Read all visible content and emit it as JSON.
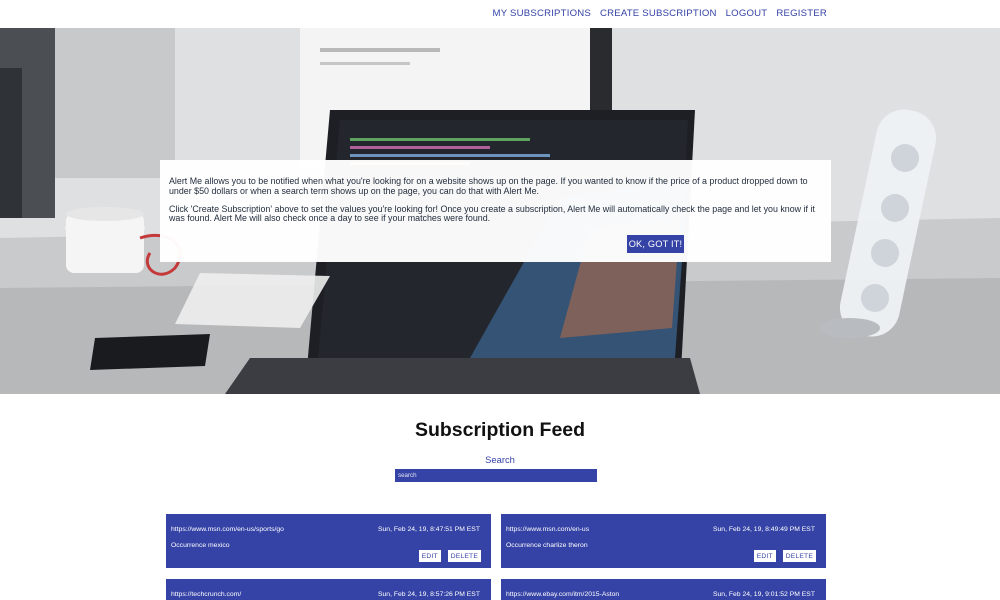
{
  "nav": {
    "my_subscriptions": "MY SUBSCRIPTIONS",
    "create_subscription": "CREATE SUBSCRIPTION",
    "logout": "LOGOUT",
    "register": "REGISTER"
  },
  "intro": {
    "paragraph1": "Alert Me allows you to be notified when what you're looking for on a website shows up on the page. If you wanted to know if the price of a product dropped down to under $50 dollars or when a search term shows up on the page, you can do that with Alert Me.",
    "paragraph2": "Click 'Create Subscription' above to set the values you're looking for! Once you create a subscription, Alert Me will automatically check the page and let you know if it was found. Alert Me will also check once a day to see if your matches were found.",
    "ok_button": "OK, GOT IT!"
  },
  "feed": {
    "title": "Subscription Feed",
    "search_label": "Search",
    "search_placeholder": "search"
  },
  "cards": [
    {
      "url": "https://www.msn.com/en-us/sports/go",
      "timestamp": "Sun, Feb 24, 19, 8:47:51 PM EST",
      "occurrence": "Occurrence mexico",
      "edit": "EDIT",
      "delete": "DELETE"
    },
    {
      "url": "https://www.msn.com/en-us",
      "timestamp": "Sun, Feb 24, 19, 8:49:49 PM EST",
      "occurrence": "Occurrence charlize theron",
      "edit": "EDIT",
      "delete": "DELETE"
    },
    {
      "url": "https://techcrunch.com/",
      "timestamp": "Sun, Feb 24, 19, 8:57:26 PM EST",
      "occurrence": "",
      "edit": "",
      "delete": ""
    },
    {
      "url": "https://www.ebay.com/itm/2015-Aston",
      "timestamp": "Sun, Feb 24, 19, 9:01:52 PM EST",
      "occurrence": "",
      "edit": "",
      "delete": ""
    }
  ],
  "colors": {
    "accent": "#3543a6",
    "text_dark": "#111111"
  }
}
